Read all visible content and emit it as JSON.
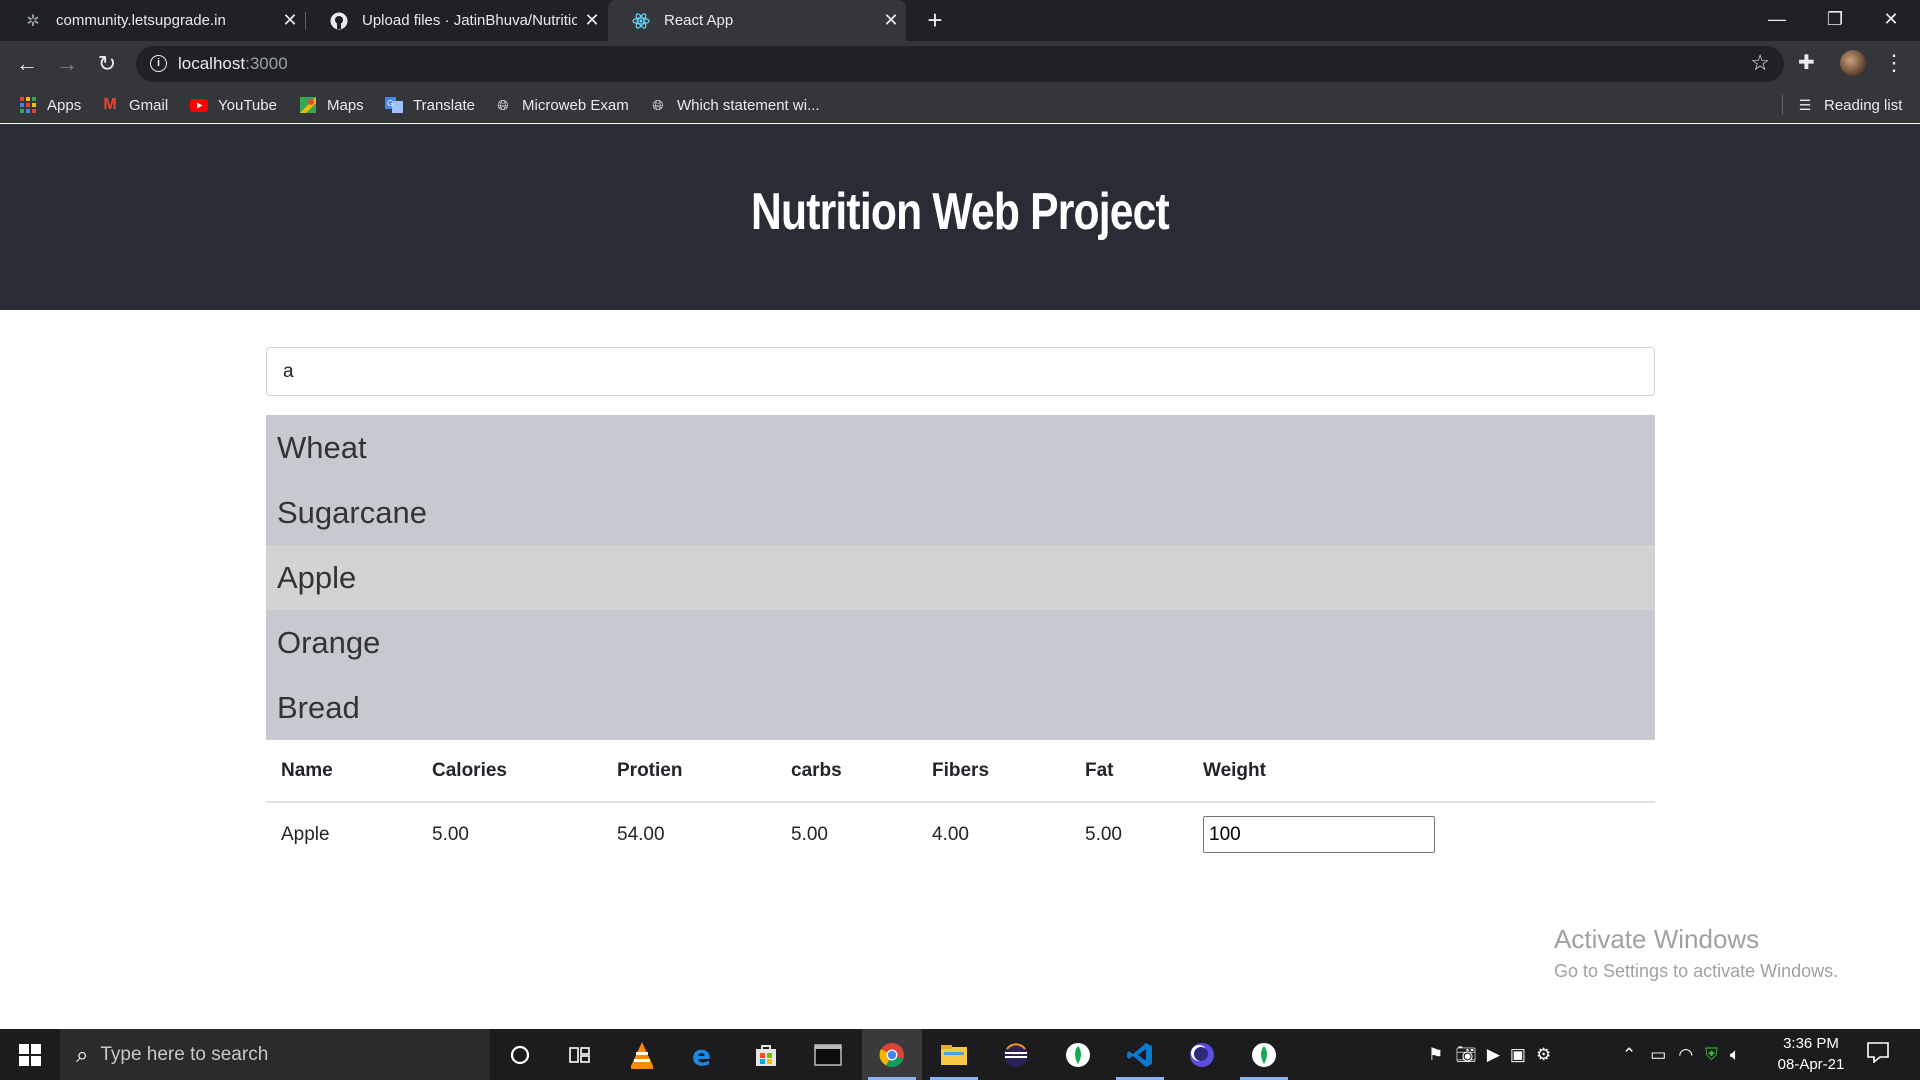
{
  "browser": {
    "tabs": [
      {
        "title": "community.letsupgrade.in",
        "icon": "letsupgrade-icon",
        "active": false
      },
      {
        "title": "Upload files · JatinBhuva/Nutritio",
        "icon": "github-icon",
        "active": false
      },
      {
        "title": "React App",
        "icon": "react-icon",
        "active": true
      }
    ],
    "new_tab_label": "+",
    "url_host": "localhost",
    "url_port": ":3000",
    "bookmarks": [
      {
        "label": "Apps",
        "icon": "apps-grid-icon"
      },
      {
        "label": "Gmail",
        "icon": "gmail-icon"
      },
      {
        "label": "YouTube",
        "icon": "youtube-icon"
      },
      {
        "label": "Maps",
        "icon": "maps-icon"
      },
      {
        "label": "Translate",
        "icon": "translate-icon"
      },
      {
        "label": "Microweb Exam",
        "icon": "globe-icon"
      },
      {
        "label": "Which statement wi...",
        "icon": "globe-icon"
      }
    ],
    "reading_list": "Reading list"
  },
  "app": {
    "title": "Nutrition Web Project",
    "search_value": "a",
    "suggestions": [
      "Wheat",
      "Sugarcane",
      "Apple",
      "Orange",
      "Bread"
    ],
    "hovered_suggestion": "Apple",
    "table": {
      "headers": [
        "Name",
        "Calories",
        "Protien",
        "carbs",
        "Fibers",
        "Fat",
        "Weight"
      ],
      "rows": [
        {
          "name": "Apple",
          "calories": "5.00",
          "protien": "54.00",
          "carbs": "5.00",
          "fibers": "4.00",
          "fat": "5.00",
          "weight": "100"
        }
      ]
    }
  },
  "watermark": {
    "line1": "Activate Windows",
    "line2": "Go to Settings to activate Windows."
  },
  "taskbar": {
    "search_placeholder": "Type here to search",
    "time": "3:36 PM",
    "date": "08-Apr-21"
  },
  "colors": {
    "hero_bg": "#282c34",
    "suggest_bg": "#c6c9cf",
    "suggest_hover": "#d3d3d4",
    "chrome_dark": "#202124",
    "chrome_toolbar": "#35363a"
  }
}
